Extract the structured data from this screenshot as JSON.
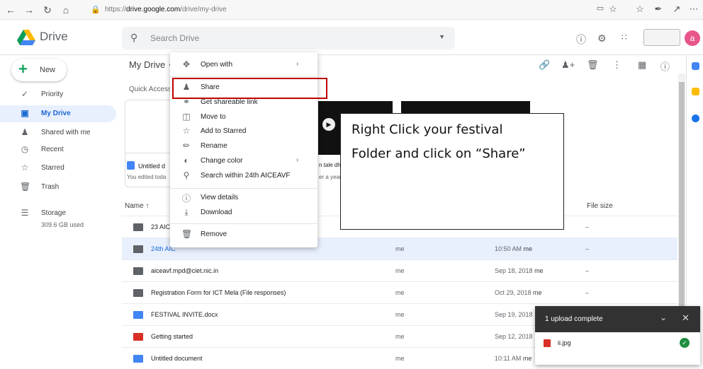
{
  "browser": {
    "url_prefix": "https://",
    "url_host": "drive.google.com",
    "url_path": "/drive/my-drive"
  },
  "header": {
    "brand": "Drive",
    "search_placeholder": "Search Drive",
    "avatar_letter": "a"
  },
  "sidebar": {
    "new_label": "New",
    "items": [
      {
        "label": "Priority",
        "icon": "check-circle-icon"
      },
      {
        "label": "My Drive",
        "icon": "my-drive-icon"
      },
      {
        "label": "Shared with me",
        "icon": "people-icon"
      },
      {
        "label": "Recent",
        "icon": "clock-icon"
      },
      {
        "label": "Starred",
        "icon": "star-icon"
      },
      {
        "label": "Trash",
        "icon": "trash-icon"
      }
    ],
    "storage_label": "Storage",
    "storage_used": "309.6 GB used"
  },
  "main": {
    "breadcrumb": "My Drive",
    "quick_access_label": "Quick Access",
    "quick_access_card": {
      "name": "Untitled d",
      "sub": "You edited toda"
    },
    "quick_access_card3": {
      "name": "n tale dh",
      "sub": "er a year"
    },
    "columns": {
      "name": "Name",
      "size": "File size"
    },
    "rows": [
      {
        "name": "23 AICE",
        "owner": "",
        "modified": "",
        "modifier": "",
        "size": "–",
        "icon": "shared-folder-icon",
        "color": "#5f6368",
        "selected": false
      },
      {
        "name": "24th AIC",
        "owner": "me",
        "modified": "10:50 AM",
        "modifier": "me",
        "size": "–",
        "icon": "folder-icon",
        "color": "#5f6368",
        "selected": true
      },
      {
        "name": "aiceavf.mpd@ciet.nic.in",
        "owner": "me",
        "modified": "Sep 18, 2018",
        "modifier": "me",
        "size": "–",
        "icon": "folder-icon",
        "color": "#5f6368",
        "selected": false
      },
      {
        "name": "Registration Form for ICT Mela (File responses)",
        "owner": "me",
        "modified": "Oct 29, 2018",
        "modifier": "me",
        "size": "–",
        "icon": "shared-folder-icon",
        "color": "#5f6368",
        "selected": false
      },
      {
        "name": "FESTIVAL INVITE.docx",
        "owner": "me",
        "modified": "Sep 19, 2018",
        "modifier": "",
        "size": "",
        "icon": "word-doc-icon",
        "color": "#4285f4",
        "selected": false
      },
      {
        "name": "Getting started",
        "owner": "me",
        "modified": "Sep 12, 2018",
        "modifier": "",
        "size": "",
        "icon": "pdf-icon",
        "color": "#d93025",
        "selected": false
      },
      {
        "name": "Untitled document",
        "owner": "me",
        "modified": "10:11 AM",
        "modifier": "me",
        "size": "–",
        "icon": "docs-icon",
        "color": "#4285f4",
        "selected": false
      }
    ]
  },
  "context_menu": {
    "items": [
      {
        "label": "Open with",
        "icon": "move-arrows-icon",
        "submenu": true
      },
      {
        "label": "Share",
        "icon": "add-person-icon",
        "submenu": false
      },
      {
        "label": "Get shareable link",
        "icon": "link-icon",
        "submenu": false
      },
      {
        "label": "Move to",
        "icon": "move-folder-icon",
        "submenu": false
      },
      {
        "label": "Add to Starred",
        "icon": "star-icon",
        "submenu": false
      },
      {
        "label": "Rename",
        "icon": "pencil-icon",
        "submenu": false
      },
      {
        "label": "Change color",
        "icon": "palette-icon",
        "submenu": true
      },
      {
        "label": "Search within 24th AICEAVF",
        "icon": "search-icon",
        "submenu": false
      },
      {
        "label": "View details",
        "icon": "info-icon",
        "submenu": false
      },
      {
        "label": "Download",
        "icon": "download-icon",
        "submenu": false
      },
      {
        "label": "Remove",
        "icon": "trash-icon",
        "submenu": false
      }
    ],
    "highlight_color": "#c00000"
  },
  "callout": {
    "line1": "Right Click your festival",
    "line2": "Folder and click on “Share”"
  },
  "toast": {
    "title": "1 upload complete",
    "file": "ii.jpg"
  }
}
